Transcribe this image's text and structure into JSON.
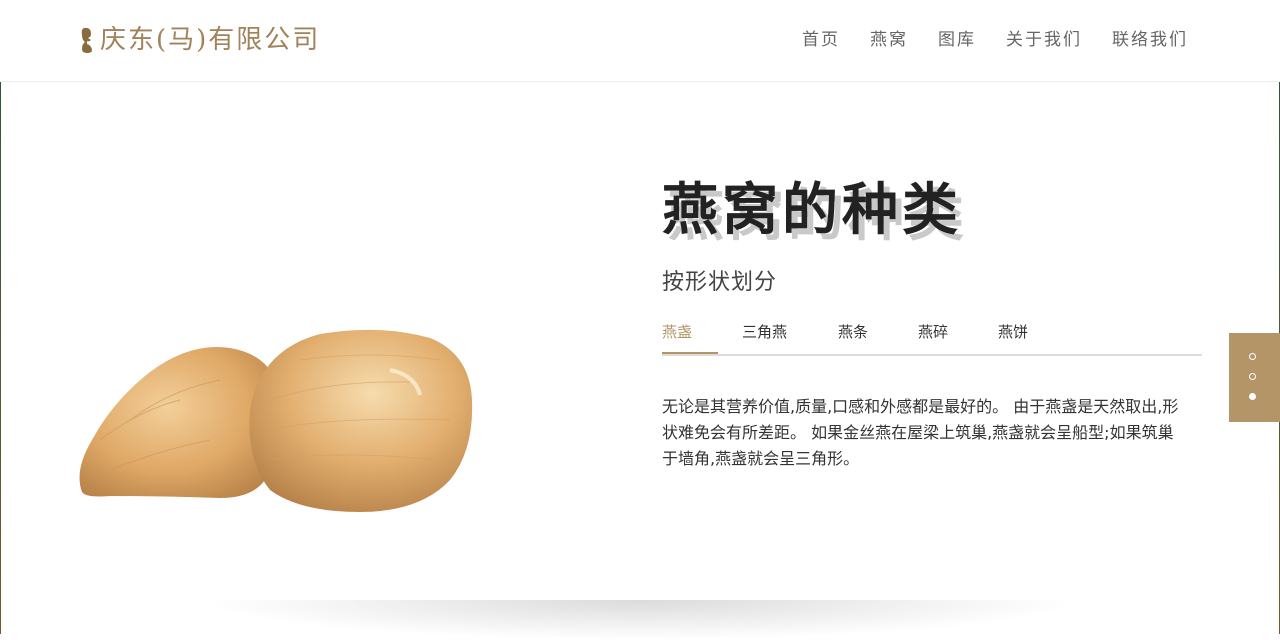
{
  "header": {
    "logo_text": "庆东(马)有限公司",
    "nav": [
      "首页",
      "燕窝",
      "图库",
      "关于我们",
      "联络我们"
    ]
  },
  "section": {
    "title": "燕窝的种类",
    "subtitle": "按形状划分",
    "tabs": [
      "燕盏",
      "三角燕",
      "燕条",
      "燕碎",
      "燕饼"
    ],
    "active_tab": "燕盏",
    "description": "无论是其营养价值,质量,口感和外感都是最好的。 由于燕盏是天然取出,形状难免会有所差距。 如果金丝燕在屋梁上筑巢,燕盏就会呈船型;如果筑巢于墙角,燕盏就会呈三角形。"
  },
  "pager": {
    "count": 3,
    "active_index": 2
  },
  "colors": {
    "accent": "#b39568",
    "logo": "#a0835a",
    "title": "#222222"
  }
}
